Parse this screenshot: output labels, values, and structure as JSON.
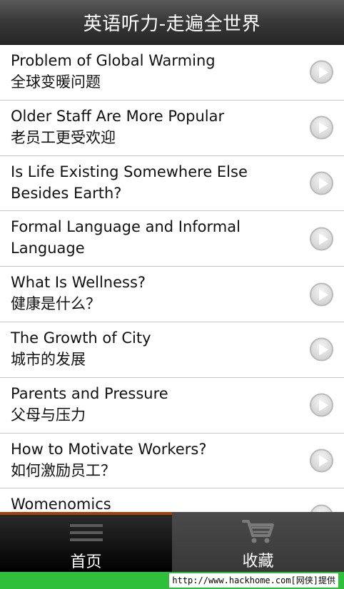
{
  "header": {
    "title": "英语听力-走遍全世界"
  },
  "articles": [
    {
      "title": "Problem of Global Warming",
      "sub": "全球变暖问题"
    },
    {
      "title": "Older Staff Are More Popular",
      "sub": "老员工更受欢迎"
    },
    {
      "title": "Is Life Existing Somewhere Else",
      "sub": "Besides Earth?"
    },
    {
      "title": "Formal Language and Informal",
      "sub": "Language"
    },
    {
      "title": "What Is Wellness?",
      "sub": "健康是什么？"
    },
    {
      "title": "The Growth of City",
      "sub": "城市的发展"
    },
    {
      "title": "Parents and Pressure",
      "sub": "父母与压力"
    },
    {
      "title": "How to Motivate Workers?",
      "sub": "如何激励员工？"
    },
    {
      "title": "Womenomics",
      "sub": ""
    }
  ],
  "tabs": {
    "home": {
      "label": "首页",
      "icon": "list-icon",
      "selected": true
    },
    "favorites": {
      "label": "收藏",
      "icon": "cart-icon",
      "selected": false
    }
  },
  "watermark": {
    "text": "http://www.hackhome.com[网侠]提供"
  },
  "colors": {
    "accent_tab": "#a0420e",
    "footer_green": "#2fbf3a"
  }
}
